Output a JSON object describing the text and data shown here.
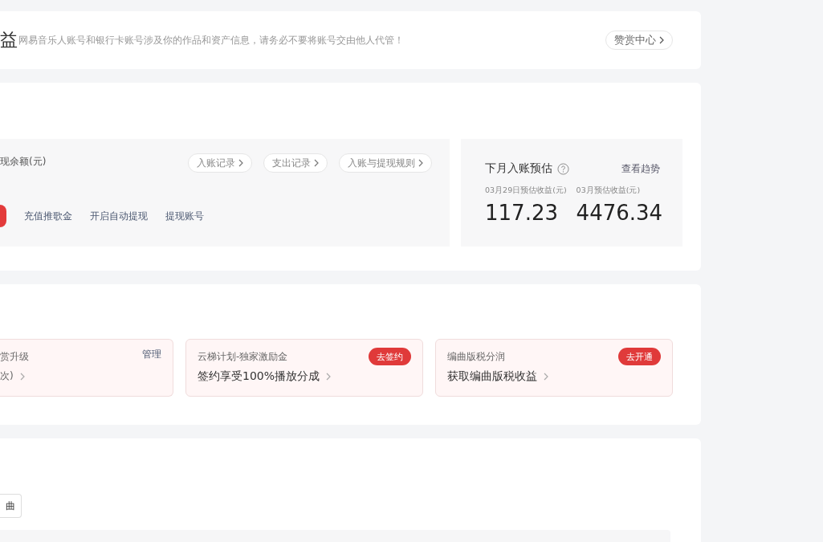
{
  "notice": {
    "title_fragment": "益",
    "text": "网易音乐人账号和银行卡账号涉及你的作品和资产信息，请务必不要将账号交由他人代管！",
    "button": "赞赏中心"
  },
  "balance": {
    "label": "现余额(元)",
    "links": [
      "入账记录",
      "支出记录",
      "入账与提现规则"
    ],
    "actions": [
      "充值推歌金",
      "开启自动提现",
      "提现账号"
    ]
  },
  "estimate": {
    "title": "下月入账预估",
    "trend_link": "查看趋势",
    "items": [
      {
        "label": "03月29日预估收益(元)",
        "value": "117.23"
      },
      {
        "label": "03月预估收益(元)",
        "value": "4476.34"
      }
    ]
  },
  "tiles": [
    {
      "kind": "manage",
      "title": "赏升级",
      "action": "管理",
      "subtitle": "次)"
    },
    {
      "kind": "badge",
      "title": "云梯计划-独家激励金",
      "action": "去签约",
      "subtitle": "签约享受100%播放分成"
    },
    {
      "kind": "badge",
      "title": "编曲版税分润",
      "action": "去开通",
      "subtitle": "获取编曲版税收益"
    }
  ],
  "filter_button": "曲"
}
